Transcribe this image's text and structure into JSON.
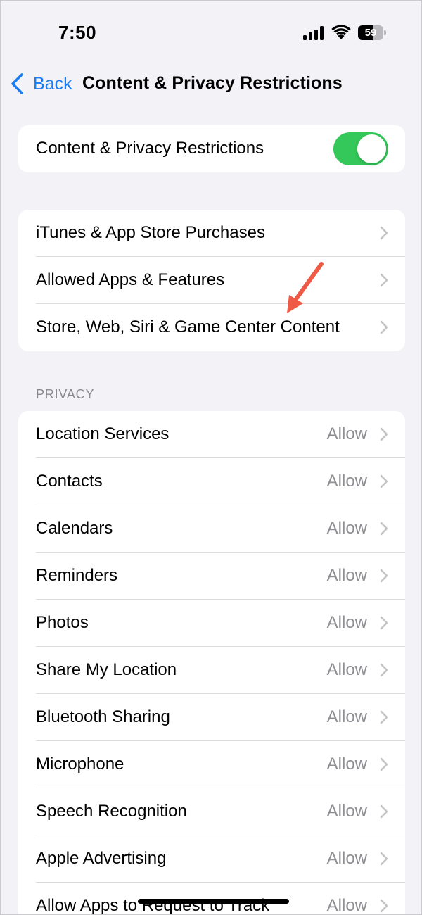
{
  "status_bar": {
    "time": "7:50",
    "battery_level": "59",
    "battery_fraction": 0.59,
    "icons": [
      "signal-icon",
      "wifi-icon",
      "battery-icon"
    ]
  },
  "nav": {
    "back_label": "Back",
    "title": "Content & Privacy Restrictions"
  },
  "master_toggle": {
    "label": "Content & Privacy Restrictions",
    "on": true
  },
  "content_group": {
    "items": [
      {
        "label": "iTunes & App Store Purchases"
      },
      {
        "label": "Allowed Apps & Features"
      },
      {
        "label": "Store, Web, Siri & Game Center Content"
      }
    ]
  },
  "privacy": {
    "header": "PRIVACY",
    "items": [
      {
        "label": "Location Services",
        "value": "Allow"
      },
      {
        "label": "Contacts",
        "value": "Allow"
      },
      {
        "label": "Calendars",
        "value": "Allow"
      },
      {
        "label": "Reminders",
        "value": "Allow"
      },
      {
        "label": "Photos",
        "value": "Allow"
      },
      {
        "label": "Share My Location",
        "value": "Allow"
      },
      {
        "label": "Bluetooth Sharing",
        "value": "Allow"
      },
      {
        "label": "Microphone",
        "value": "Allow"
      },
      {
        "label": "Speech Recognition",
        "value": "Allow"
      },
      {
        "label": "Apple Advertising",
        "value": "Allow"
      },
      {
        "label": "Allow Apps to Request to Track",
        "value": "Allow"
      }
    ]
  },
  "colors": {
    "accent": "#1a7cf5",
    "toggle_on": "#34c759",
    "annotation_arrow": "#ef5a46",
    "background": "#f2f2f7"
  }
}
